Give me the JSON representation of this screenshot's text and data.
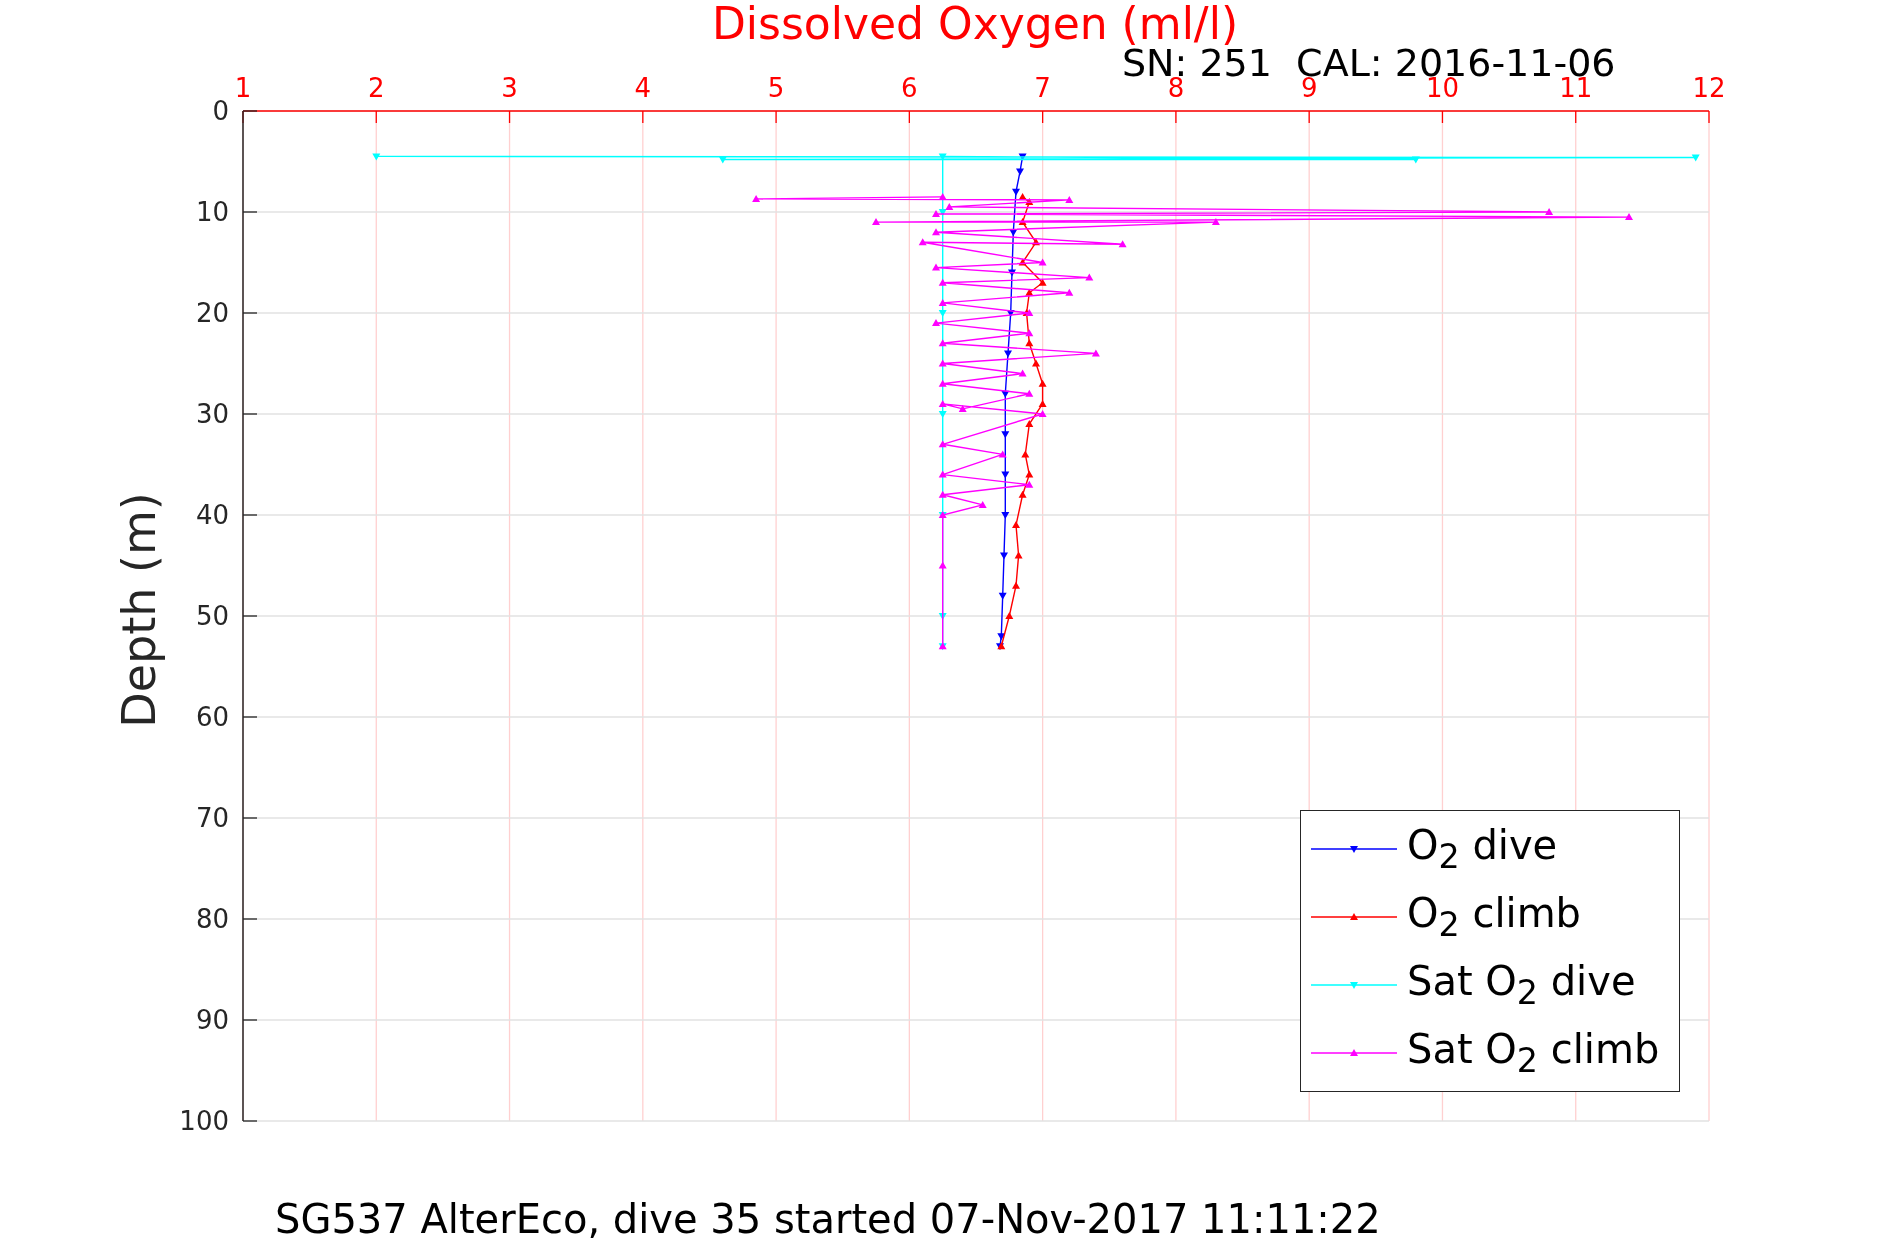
{
  "figure": {
    "downward_markers": [
      true,
      false,
      true,
      false
    ],
    "subtitle": "SN: 251  CAL: 2016-11-06",
    "caption": "SG537 AlterEco, dive 35 started 07-Nov-2017 11:11:22",
    "chart_data": {
      "type": "line",
      "grid": true,
      "xlabel": "Dissolved Oxygen (ml/l)",
      "ylabel": "Depth (m)",
      "xlim": [
        1,
        12
      ],
      "ylim": [
        100,
        0
      ],
      "xticks": [
        1,
        2,
        3,
        4,
        5,
        6,
        7,
        8,
        9,
        10,
        11,
        12
      ],
      "yticks": [
        0,
        10,
        20,
        30,
        40,
        50,
        60,
        70,
        80,
        90,
        100
      ],
      "series": [
        {
          "name": "O$_{2}$ dive",
          "color": "#0000ff",
          "marker": "triangle",
          "x": [
            6.85,
            6.83,
            6.8,
            6.78,
            6.77,
            6.76,
            6.74,
            6.72,
            6.72,
            6.72,
            6.72,
            6.71,
            6.7,
            6.69,
            6.68
          ],
          "values": [
            4.5,
            6,
            8,
            12,
            16,
            20,
            24,
            28,
            32,
            36,
            40,
            44,
            48,
            52,
            53
          ]
        },
        {
          "name": "O$_{2}$ climb",
          "color": "#ff0000",
          "marker": "triangle",
          "x": [
            6.69,
            6.75,
            6.8,
            6.82,
            6.8,
            6.85,
            6.9,
            6.87,
            6.9,
            7.0,
            7.0,
            6.95,
            6.9,
            6.88,
            6.9,
            7.0,
            6.85,
            6.95,
            6.85,
            6.9,
            6.85
          ],
          "values": [
            53,
            50,
            47,
            44,
            41,
            38,
            36,
            34,
            31,
            29,
            27,
            25,
            23,
            20,
            18,
            17,
            15,
            13,
            11,
            9,
            8.5
          ]
        },
        {
          "name": "Sat O$_{2}$ dive",
          "color": "#00ffff",
          "marker": "triangle",
          "x": [
            2.0,
            11.9,
            4.6,
            9.8,
            6.25,
            6.25,
            6.25,
            6.25,
            6.25,
            6.25,
            6.25
          ],
          "values": [
            4.5,
            4.6,
            4.8,
            4.8,
            4.5,
            10,
            20,
            30,
            40,
            50,
            53
          ]
        },
        {
          "name": "Sat O$_{2}$ climb",
          "color": "#ff00ff",
          "marker": "triangle",
          "x": [
            6.25,
            6.25,
            6.25,
            6.55,
            6.25,
            6.9,
            6.25,
            6.7,
            6.25,
            7.0,
            6.25,
            6.4,
            6.9,
            6.25,
            6.85,
            6.25,
            7.4,
            6.25,
            6.9,
            6.2,
            6.9,
            6.25,
            7.2,
            6.25,
            7.35,
            6.2,
            7.0,
            6.1,
            7.6,
            6.2,
            8.3,
            5.75,
            11.4,
            6.2,
            10.8,
            6.3,
            7.2,
            4.85,
            6.25
          ],
          "values": [
            53,
            45,
            40,
            39,
            38,
            37,
            36,
            34,
            33,
            30,
            29,
            29.5,
            28,
            27,
            26,
            25,
            24,
            23,
            22,
            21,
            20,
            19,
            18,
            17,
            16.5,
            15.5,
            15,
            13,
            13.2,
            12,
            11,
            11,
            10.5,
            10.2,
            10,
            9.5,
            8.8,
            8.7,
            8.5
          ]
        }
      ]
    }
  }
}
